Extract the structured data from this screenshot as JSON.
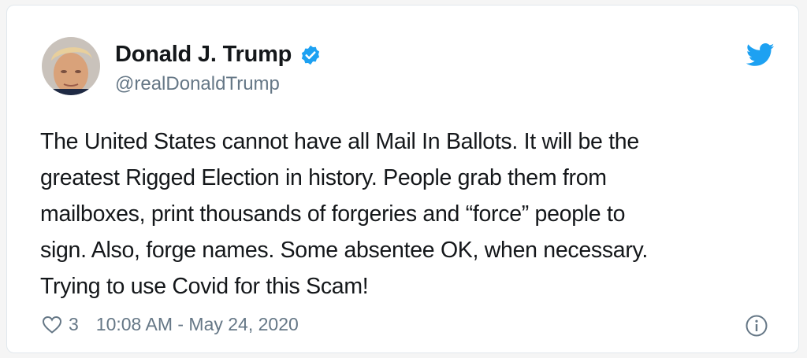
{
  "user": {
    "display_name": "Donald J. Trump",
    "handle": "@realDonaldTrump",
    "verified": true,
    "avatar": "profile-photo"
  },
  "tweet": {
    "text": "The United States cannot have all Mail In Ballots. It will be the\ngreatest Rigged Election in history. People grab them from\nmailboxes, print thousands of forgeries and “force” people to\nsign. Also, forge names. Some absentee OK, when necessary.\nTrying to use Covid for this Scam!"
  },
  "footer": {
    "like_count": "3",
    "timestamp": "10:08 AM - May 24, 2020"
  },
  "icons": {
    "brand": "twitter-bird-icon",
    "verified": "verified-badge-icon",
    "like": "heart-icon",
    "info": "info-icon"
  },
  "colors": {
    "brand": "#1da1f2",
    "text": "#14171a",
    "secondary": "#657786",
    "border": "#e1e8ed"
  }
}
